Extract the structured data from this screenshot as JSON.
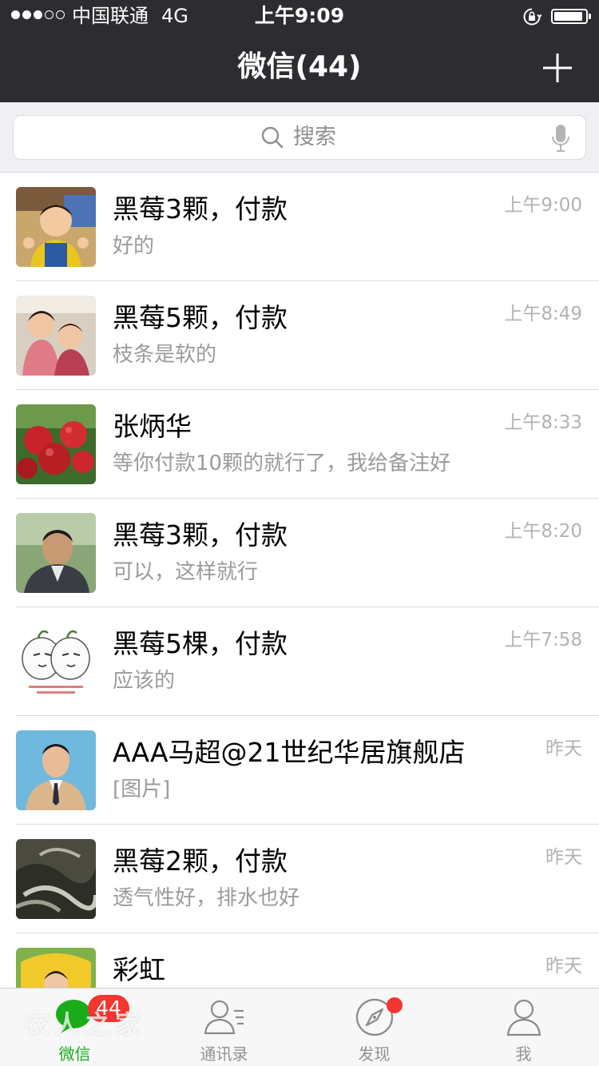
{
  "status_bar": {
    "carrier": "中国联通",
    "network": "4G",
    "time": "上午9:09",
    "signal_strength": 3,
    "signal_max": 5,
    "battery_level": 0.92
  },
  "nav": {
    "title": "微信(44)",
    "add_icon": "plus-icon"
  },
  "search": {
    "placeholder": "搜索",
    "icon": "search-icon",
    "voice_icon": "mic-icon"
  },
  "chats": [
    {
      "name": "黑莓3颗，付款",
      "preview": "好的",
      "time": "上午9:00",
      "avatar": "child-photo"
    },
    {
      "name": "黑莓5颗，付款",
      "preview": "枝条是软的",
      "time": "上午8:49",
      "avatar": "two-children-photo"
    },
    {
      "name": "张炳华",
      "preview": "等你付款10颗的就行了，我给备注好",
      "time": "上午8:33",
      "avatar": "red-apples-photo"
    },
    {
      "name": "黑莓3颗，付款",
      "preview": "可以，这样就行",
      "time": "上午8:20",
      "avatar": "man-photo"
    },
    {
      "name": "黑莓5棵，付款",
      "preview": "应该的",
      "time": "上午7:58",
      "avatar": "cartoon-sticker"
    },
    {
      "name": "AAA马超@21世纪华居旗舰店",
      "preview": "[图片]",
      "time": "昨天",
      "avatar": "man-in-suit-photo"
    },
    {
      "name": "黑莓2颗，付款",
      "preview": "透气性好，排水也好",
      "time": "昨天",
      "avatar": "dark-painting"
    },
    {
      "name": "彩虹",
      "preview": "",
      "time": "昨天",
      "avatar": "child-in-toy-car-photo"
    }
  ],
  "tab_bar": {
    "tabs": [
      {
        "label": "微信",
        "icon": "chat-bubble-icon",
        "active": true,
        "badge": "44"
      },
      {
        "label": "通讯录",
        "icon": "contacts-icon",
        "active": false
      },
      {
        "label": "发现",
        "icon": "compass-icon",
        "active": false,
        "dot": true
      },
      {
        "label": "我",
        "icon": "person-icon",
        "active": false
      }
    ]
  },
  "watermark": "农人之家",
  "colors": {
    "header": "#2d2d31",
    "accent": "#1aad19",
    "badge": "#f43530",
    "secondary_text": "#9b9b9b"
  }
}
